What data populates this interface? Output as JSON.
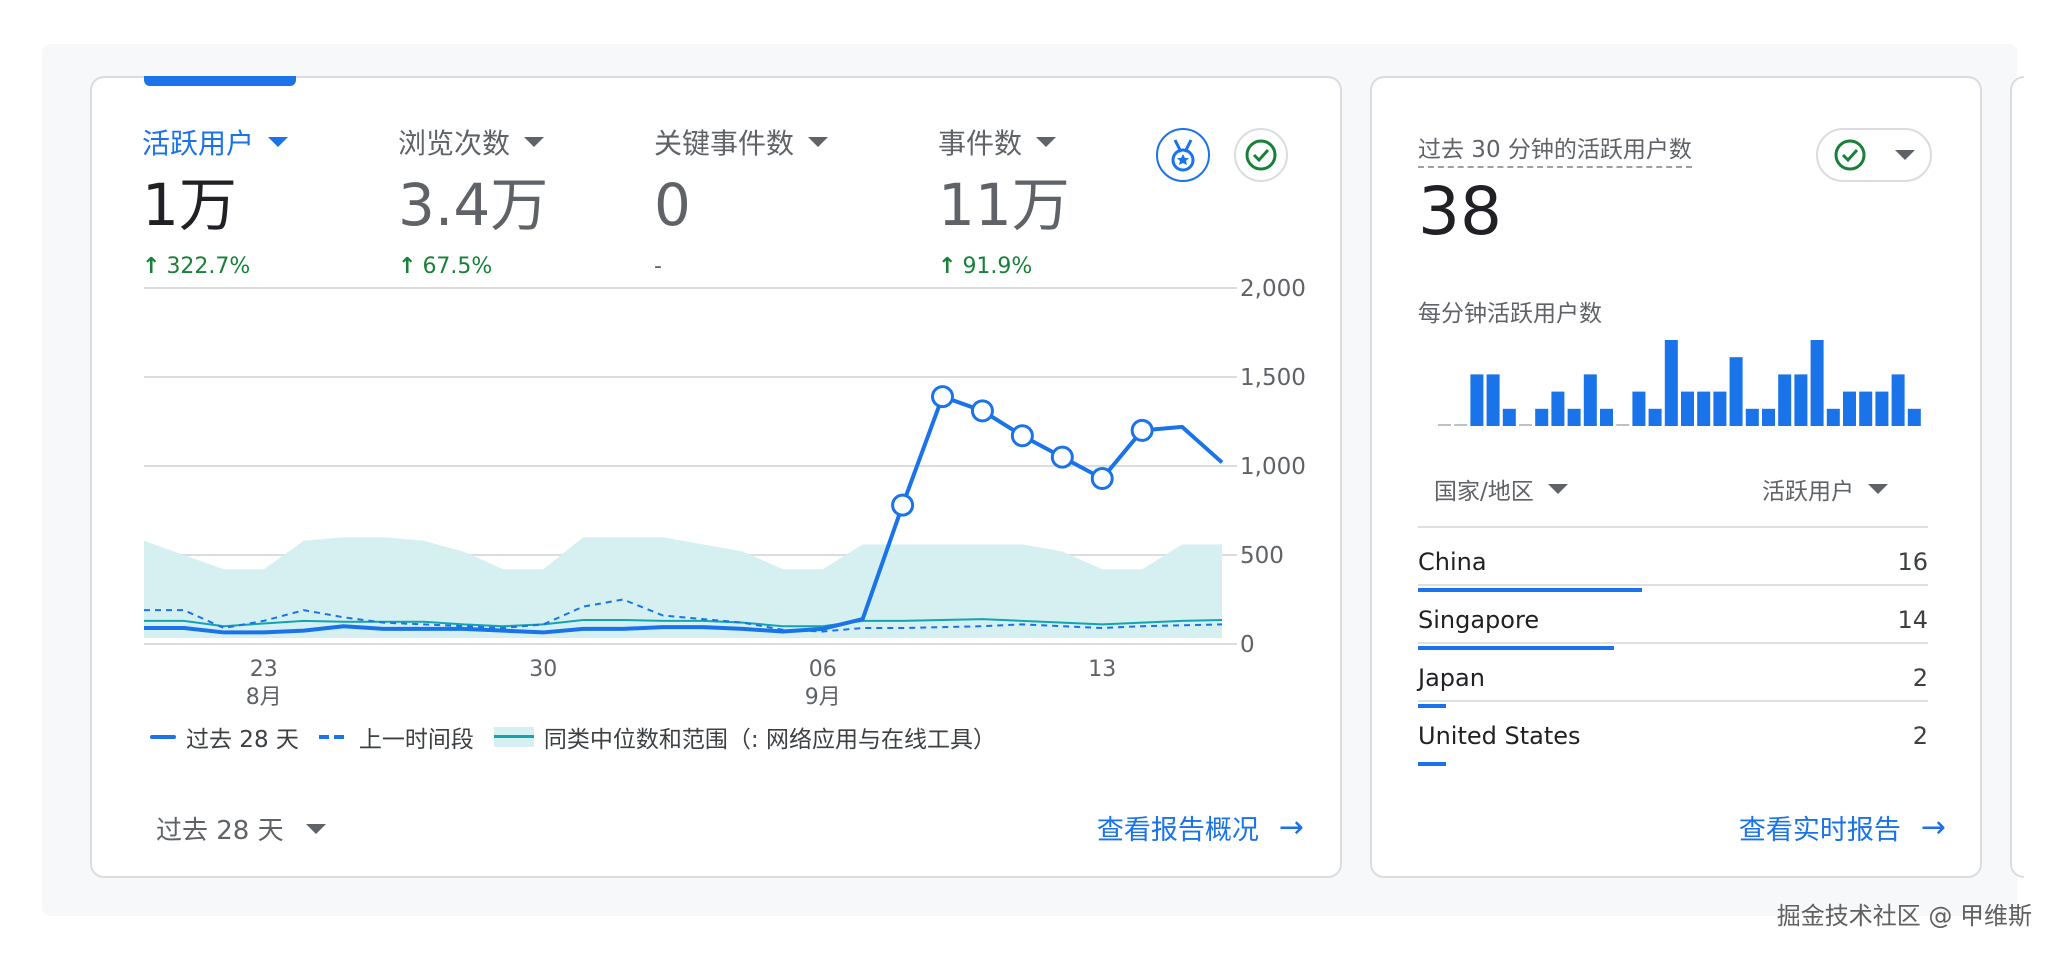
{
  "metrics": [
    {
      "label": "活跃用户",
      "value": "1万",
      "change": "322.7%",
      "trend": "up",
      "active": true
    },
    {
      "label": "浏览次数",
      "value": "3.4万",
      "change": "67.5%",
      "trend": "up",
      "active": false
    },
    {
      "label": "关键事件数",
      "value": "0",
      "change": "-",
      "trend": "none",
      "active": false
    },
    {
      "label": "事件数",
      "value": "11万",
      "change": "91.9%",
      "trend": "up",
      "active": false
    }
  ],
  "chart_data": {
    "type": "line",
    "y_ticks": [
      "2,000",
      "1,500",
      "1,000",
      "500",
      "0"
    ],
    "ylim": [
      0,
      2000
    ],
    "x_ticks": [
      {
        "day": "23",
        "month": "8月",
        "index": 3
      },
      {
        "day": "30",
        "month": "",
        "index": 10
      },
      {
        "day": "06",
        "month": "9月",
        "index": 17
      },
      {
        "day": "13",
        "month": "",
        "index": 24
      }
    ],
    "series": [
      {
        "name": "过去 28 天",
        "style": "solid",
        "values": [
          90,
          90,
          65,
          65,
          75,
          100,
          85,
          85,
          85,
          75,
          65,
          85,
          85,
          95,
          95,
          85,
          70,
          85,
          140,
          780,
          1390,
          1310,
          1170,
          1050,
          930,
          1200,
          1220,
          1020
        ]
      },
      {
        "name": "上一时间段",
        "style": "dashed",
        "values": [
          190,
          190,
          90,
          130,
          190,
          150,
          120,
          110,
          100,
          90,
          110,
          210,
          250,
          160,
          140,
          120,
          80,
          70,
          90,
          90,
          95,
          100,
          110,
          100,
          90,
          100,
          105,
          110
        ]
      },
      {
        "name": "同类中位数和范围（: 网络应用与在线工具）",
        "style": "band",
        "median": [
          130,
          130,
          100,
          115,
          130,
          125,
          125,
          125,
          110,
          100,
          110,
          135,
          135,
          130,
          130,
          120,
          100,
          100,
          130,
          130,
          135,
          140,
          130,
          120,
          110,
          120,
          130,
          135
        ],
        "upper": [
          580,
          500,
          420,
          420,
          580,
          600,
          600,
          580,
          520,
          420,
          420,
          600,
          600,
          600,
          560,
          520,
          420,
          420,
          560,
          560,
          560,
          560,
          560,
          520,
          420,
          420,
          560,
          560
        ]
      }
    ],
    "highlighted_points": [
      19,
      20,
      21,
      22,
      23,
      24,
      25
    ],
    "colors": {
      "current": "#1a73e8",
      "previous": "#1a73e8",
      "median": "#12a4af",
      "band": "#d6f0f1",
      "grid": "#dadce0"
    }
  },
  "date_range": {
    "label": "过去 28 天"
  },
  "view_report_link": "查看报告概况",
  "realtime": {
    "title": "过去 30 分钟的活跃用户数",
    "value": "38",
    "subtitle": "每分钟活跃用户数",
    "per_minute": [
      0,
      0,
      3,
      3,
      1,
      0,
      1,
      2,
      1,
      3,
      1,
      0,
      2,
      1,
      5,
      2,
      2,
      2,
      4,
      1,
      1,
      3,
      3,
      5,
      1,
      2,
      2,
      2,
      3,
      1
    ],
    "col_country": "国家/地区",
    "col_users": "活跃用户",
    "rows": [
      {
        "country": "China",
        "count": "16",
        "share": 0.44
      },
      {
        "country": "Singapore",
        "count": "14",
        "share": 0.385
      },
      {
        "country": "Japan",
        "count": "2",
        "share": 0.055
      },
      {
        "country": "United States",
        "count": "2",
        "share": 0.055
      }
    ],
    "link": "查看实时报告"
  },
  "watermark": "掘金技术社区 @ 甲维斯"
}
